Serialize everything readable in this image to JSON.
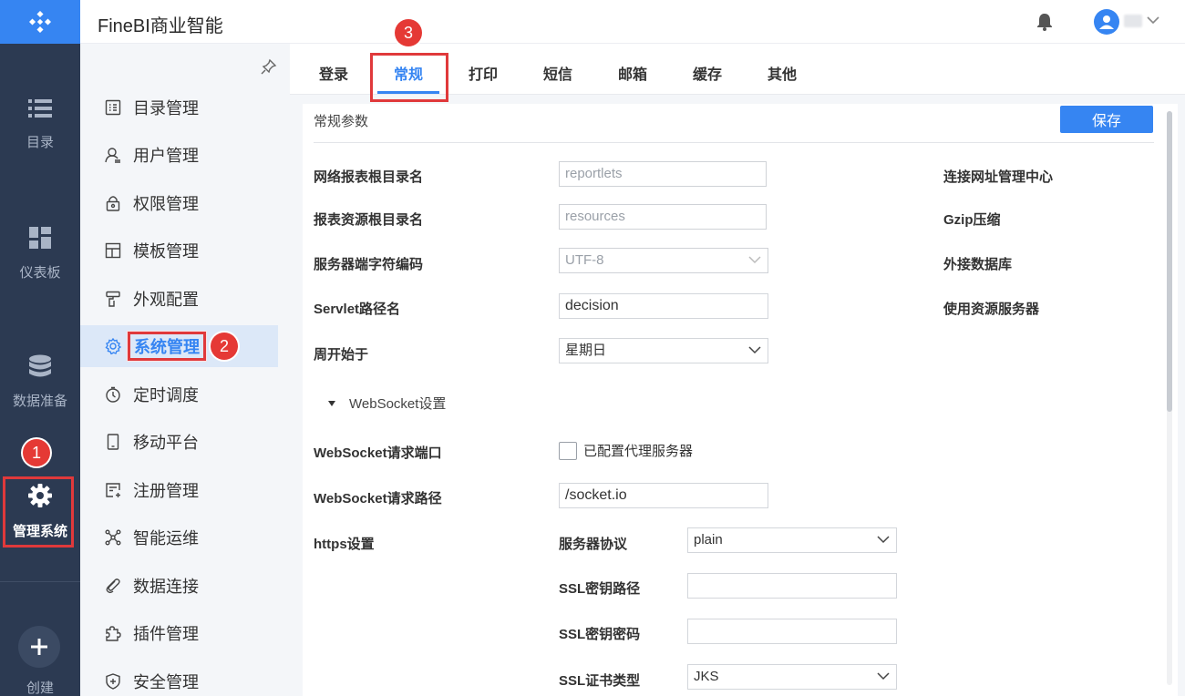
{
  "app": {
    "title": "FineBI商业智能"
  },
  "rail": {
    "items": [
      {
        "label": "目录",
        "icon": "list-icon"
      },
      {
        "label": "仪表板",
        "icon": "dashboard-icon"
      },
      {
        "label": "数据准备",
        "icon": "database-icon"
      },
      {
        "label": "管理系统",
        "icon": "gear-icon",
        "active": true
      }
    ],
    "create_label": "创建"
  },
  "sidebar": {
    "items": [
      {
        "label": "目录管理",
        "icon": "catalog-icon"
      },
      {
        "label": "用户管理",
        "icon": "user-icon"
      },
      {
        "label": "权限管理",
        "icon": "lock-icon"
      },
      {
        "label": "模板管理",
        "icon": "template-icon"
      },
      {
        "label": "外观配置",
        "icon": "brush-icon"
      },
      {
        "label": "系统管理",
        "icon": "gear-icon",
        "active": true
      },
      {
        "label": "定时调度",
        "icon": "timer-icon"
      },
      {
        "label": "移动平台",
        "icon": "mobile-icon"
      },
      {
        "label": "注册管理",
        "icon": "register-icon"
      },
      {
        "label": "智能运维",
        "icon": "network-icon"
      },
      {
        "label": "数据连接",
        "icon": "link-icon"
      },
      {
        "label": "插件管理",
        "icon": "puzzle-icon"
      },
      {
        "label": "安全管理",
        "icon": "shield-icon"
      }
    ]
  },
  "tabs": [
    {
      "label": "登录"
    },
    {
      "label": "常规",
      "active": true
    },
    {
      "label": "打印"
    },
    {
      "label": "短信"
    },
    {
      "label": "邮箱"
    },
    {
      "label": "缓存"
    },
    {
      "label": "其他"
    }
  ],
  "panel": {
    "title": "常规参数",
    "save_label": "保存",
    "fields": {
      "web_report_root": {
        "label": "网络报表根目录名",
        "placeholder": "reportlets"
      },
      "report_resource_root": {
        "label": "报表资源根目录名",
        "placeholder": "resources"
      },
      "server_charset": {
        "label": "服务器端字符编码",
        "value": "UTF-8"
      },
      "servlet_path": {
        "label": "Servlet路径名",
        "value": "decision"
      },
      "week_start": {
        "label": "周开始于",
        "value": "星期日"
      }
    },
    "right_labels": [
      "连接网址管理中心",
      "Gzip压缩",
      "外接数据库",
      "使用资源服务器"
    ],
    "websocket": {
      "section_label": "WebSocket设置",
      "port_label": "WebSocket请求端口",
      "proxy_checkbox_label": "已配置代理服务器",
      "path_label": "WebSocket请求路径",
      "path_value": "/socket.io"
    },
    "https": {
      "label": "https设置",
      "protocol_label": "服务器协议",
      "protocol_value": "plain",
      "ssl_key_path_label": "SSL密钥路径",
      "ssl_key_password_label": "SSL密钥密码",
      "ssl_cert_type_label": "SSL证书类型",
      "ssl_cert_type_value": "JKS"
    }
  },
  "callouts": [
    "1",
    "2",
    "3"
  ],
  "colors": {
    "accent": "#3685f2",
    "rail_bg": "#2c3a52",
    "callout": "#e53935"
  }
}
